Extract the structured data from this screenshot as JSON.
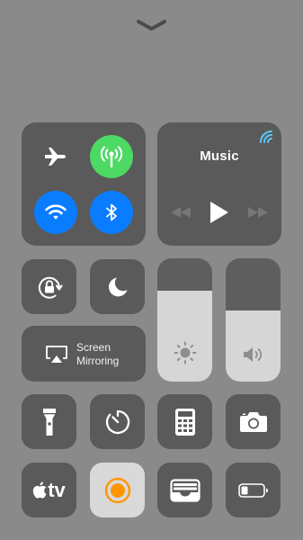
{
  "top": {
    "handle_icon": "chevron-down-icon"
  },
  "connectivity": {
    "airplane": {
      "icon": "airplane-icon",
      "active": false
    },
    "cellular": {
      "icon": "cellular-antenna-icon",
      "active": true,
      "color": "#4cd964"
    },
    "wifi": {
      "icon": "wifi-icon",
      "active": true,
      "color": "#0a7cff"
    },
    "bluetooth": {
      "icon": "bluetooth-icon",
      "active": true,
      "color": "#0a7cff"
    }
  },
  "music": {
    "title": "Music",
    "airplay_icon": "airplay-audio-icon",
    "accent": "#5ac8fa",
    "controls": [
      "rewind-icon",
      "play-icon",
      "fast-forward-icon"
    ]
  },
  "toggles": {
    "orientation_lock": "rotation-lock-icon",
    "do_not_disturb": "moon-icon"
  },
  "screen_mirroring": {
    "line1": "Screen",
    "line2": "Mirroring",
    "icon": "airplay-screen-icon"
  },
  "sliders": {
    "brightness": {
      "icon": "sun-icon",
      "level": 0.74
    },
    "volume": {
      "icon": "speaker-icon",
      "level": 0.58
    }
  },
  "row3": [
    "flashlight-icon",
    "timer-icon",
    "calculator-icon",
    "camera-icon"
  ],
  "row4": {
    "apple_tv_text": "tv",
    "record": {
      "icon": "screen-record-icon",
      "color": "#ff9500"
    },
    "wallet": "wallet-icon",
    "low_power": "battery-icon"
  }
}
